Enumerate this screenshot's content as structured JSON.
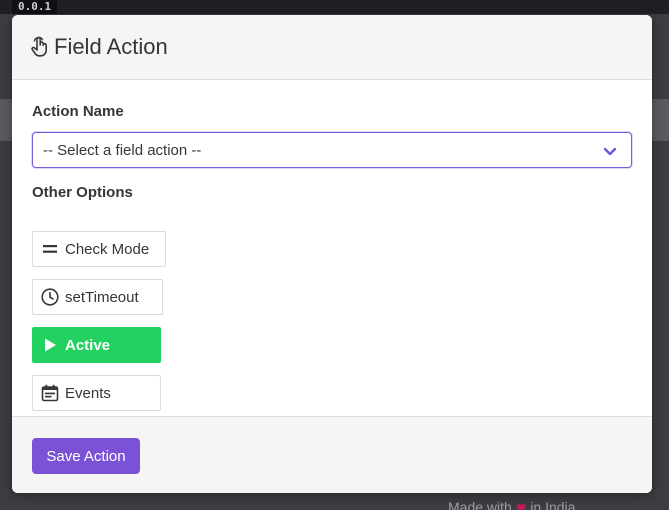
{
  "background": {
    "version_badge": "0.0.1",
    "footer_text_start": "Made with",
    "footer_text_end": "in India"
  },
  "modal": {
    "title": "Field Action",
    "title_icon": "pointing-hand-icon",
    "action_name_label": "Action Name",
    "action_select": {
      "value": "-- Select a field action --"
    },
    "other_options_label": "Other Options",
    "options": [
      {
        "label": "Check Mode",
        "icon": "equals-icon",
        "active": false
      },
      {
        "label": "setTimeout",
        "icon": "clock-icon",
        "active": false
      },
      {
        "label": "Active",
        "icon": "play-icon",
        "active": true
      },
      {
        "label": "Events",
        "icon": "calendar-icon",
        "active": false
      }
    ],
    "save_label": "Save Action"
  },
  "colors": {
    "accent": "#7b52d6",
    "active_green": "#23d160",
    "select_border": "#7b5bd6"
  }
}
